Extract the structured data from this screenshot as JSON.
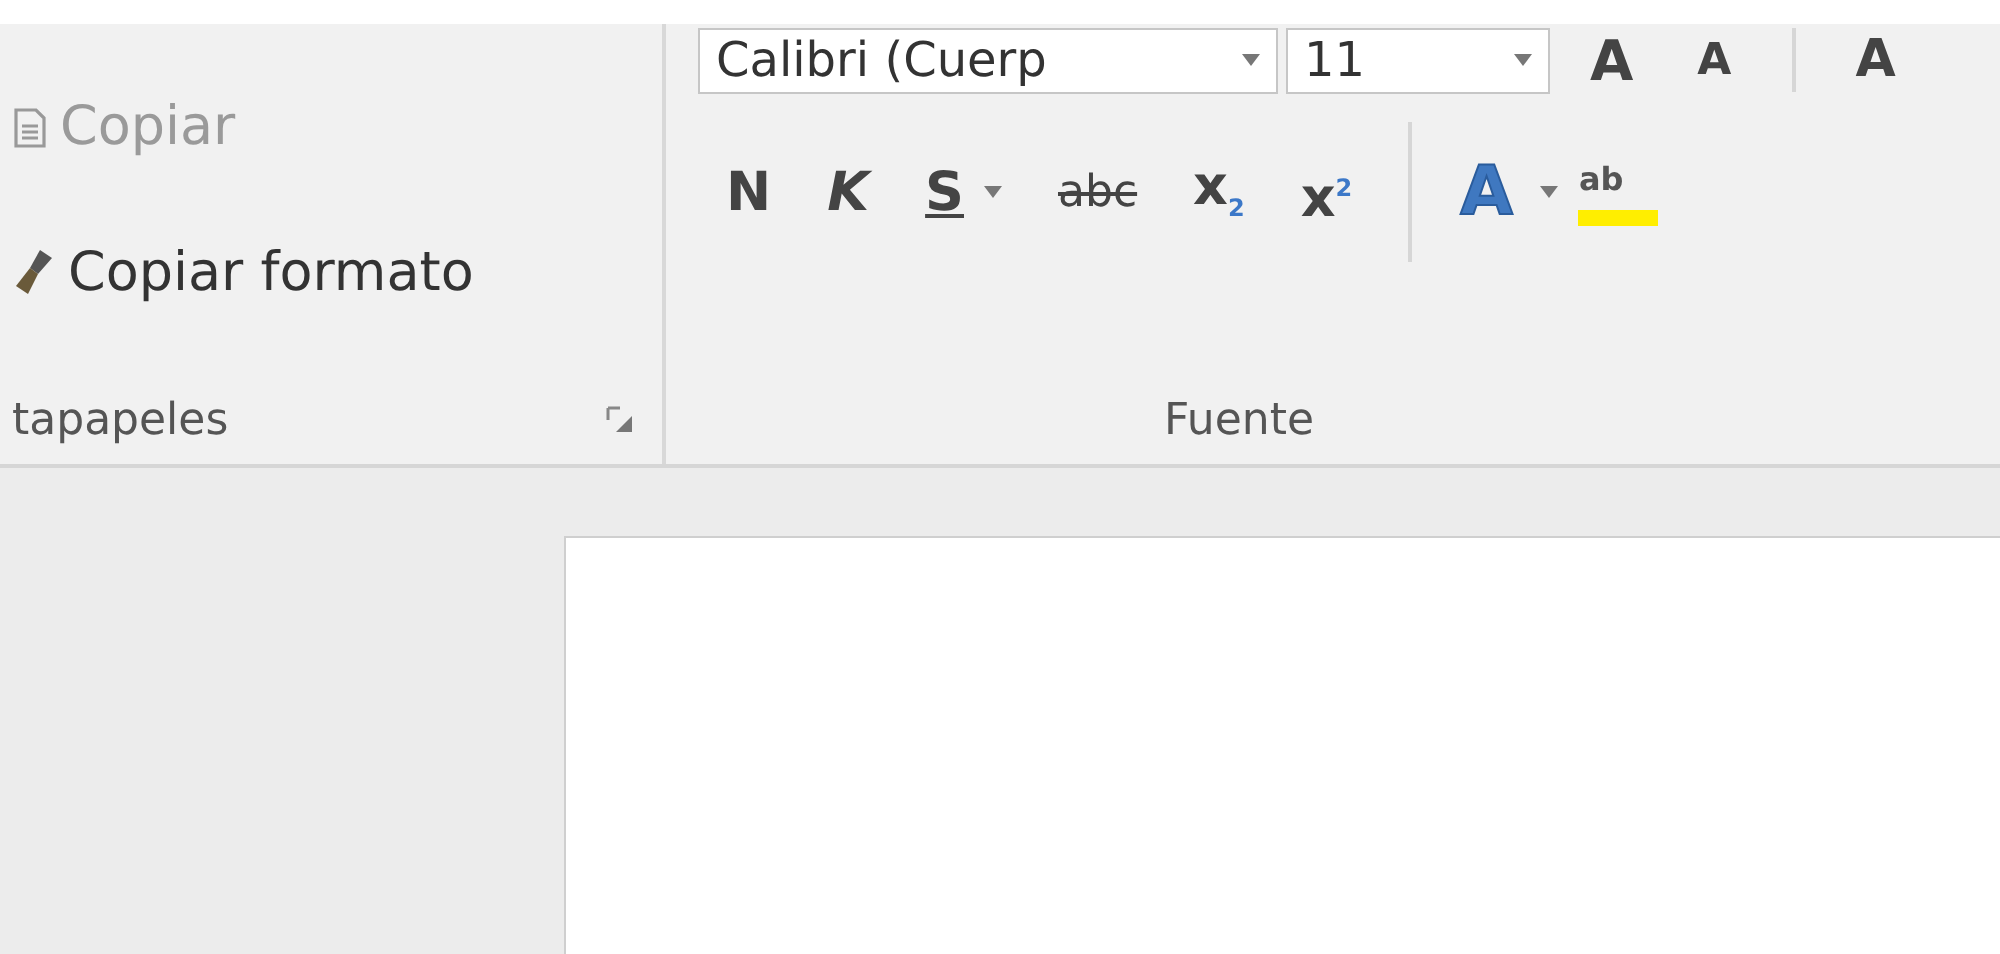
{
  "clipboard": {
    "items": [
      {
        "kind": "copy",
        "label": "Copiar",
        "disabled": true
      },
      {
        "kind": "format_painter",
        "label": "Copiar formato",
        "disabled": false
      }
    ],
    "group_label": "tapapeles"
  },
  "font": {
    "font_name": "Calibri (Cuerp",
    "font_size": "11",
    "size_buttons": [
      "A",
      "A"
    ],
    "change_case": "A",
    "format_buttons": [
      {
        "kind": "bold",
        "label": "N"
      },
      {
        "kind": "italic",
        "label": "K"
      },
      {
        "kind": "underline",
        "label": "S"
      },
      {
        "kind": "strike",
        "label": "abc"
      },
      {
        "kind": "sub",
        "label": "x",
        "mark": "2"
      },
      {
        "kind": "sup",
        "label": "x",
        "mark": "2"
      }
    ],
    "effects": "A",
    "highlight": "ab",
    "group_label": "Fuente"
  }
}
